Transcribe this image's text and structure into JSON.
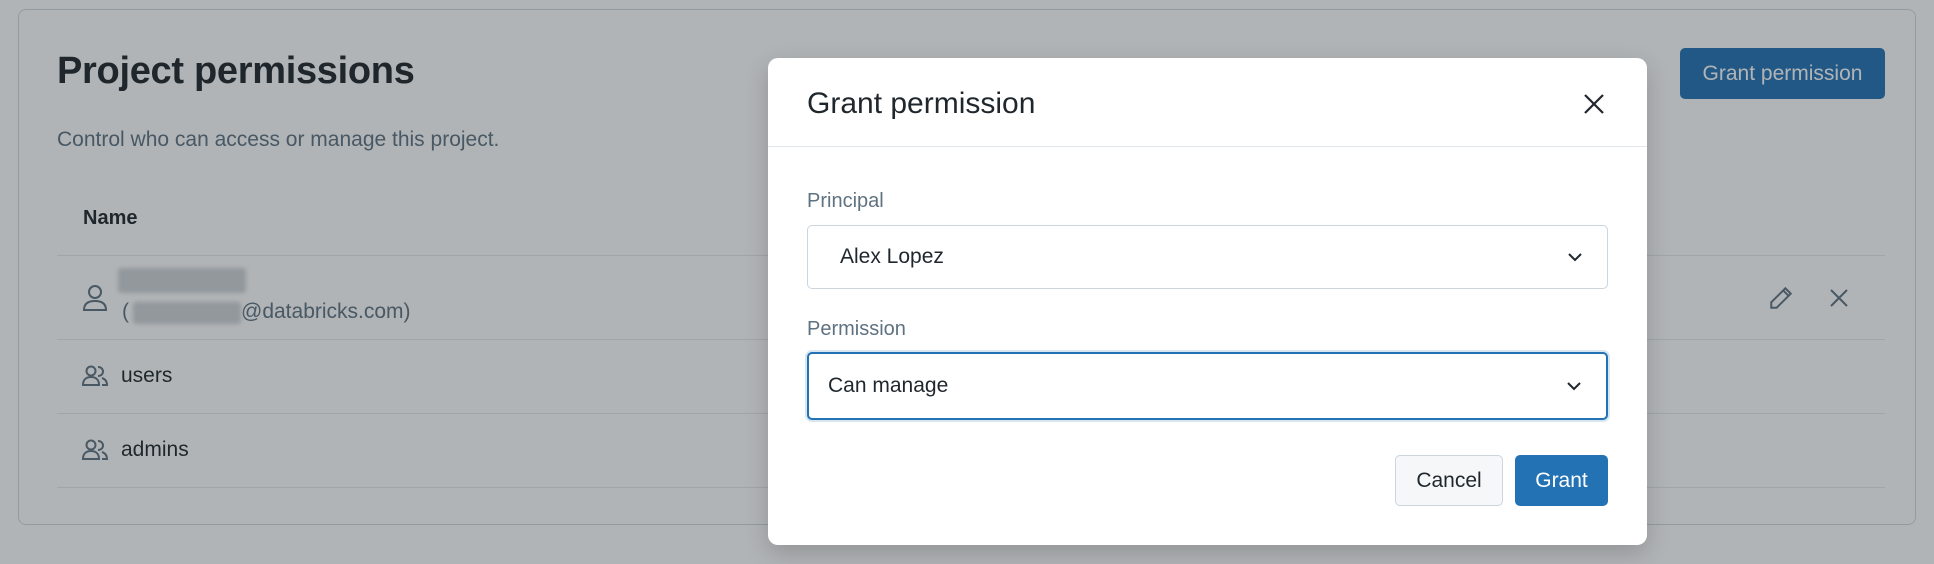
{
  "page": {
    "title": "Project permissions",
    "subtitle": "Control who can access or manage this project.",
    "grant_button": "Grant permission",
    "table": {
      "column_name": "Name",
      "rows": [
        {
          "type": "user",
          "name": "",
          "email_prefix": "(",
          "email_domain": "@databricks.com)",
          "icon": "user-icon"
        },
        {
          "type": "group",
          "name": "users",
          "icon": "group-icon"
        },
        {
          "type": "group",
          "name": "admins",
          "icon": "group-icon"
        }
      ]
    }
  },
  "modal": {
    "title": "Grant permission",
    "principal": {
      "label": "Principal",
      "value": "Alex Lopez"
    },
    "permission": {
      "label": "Permission",
      "value": "Can manage"
    },
    "cancel_label": "Cancel",
    "grant_label": "Grant"
  },
  "colors": {
    "primary": "#2272b4",
    "text": "#1f272d",
    "secondary_text": "#5f7281",
    "overlay": "rgba(31,39,45,0.35)"
  }
}
